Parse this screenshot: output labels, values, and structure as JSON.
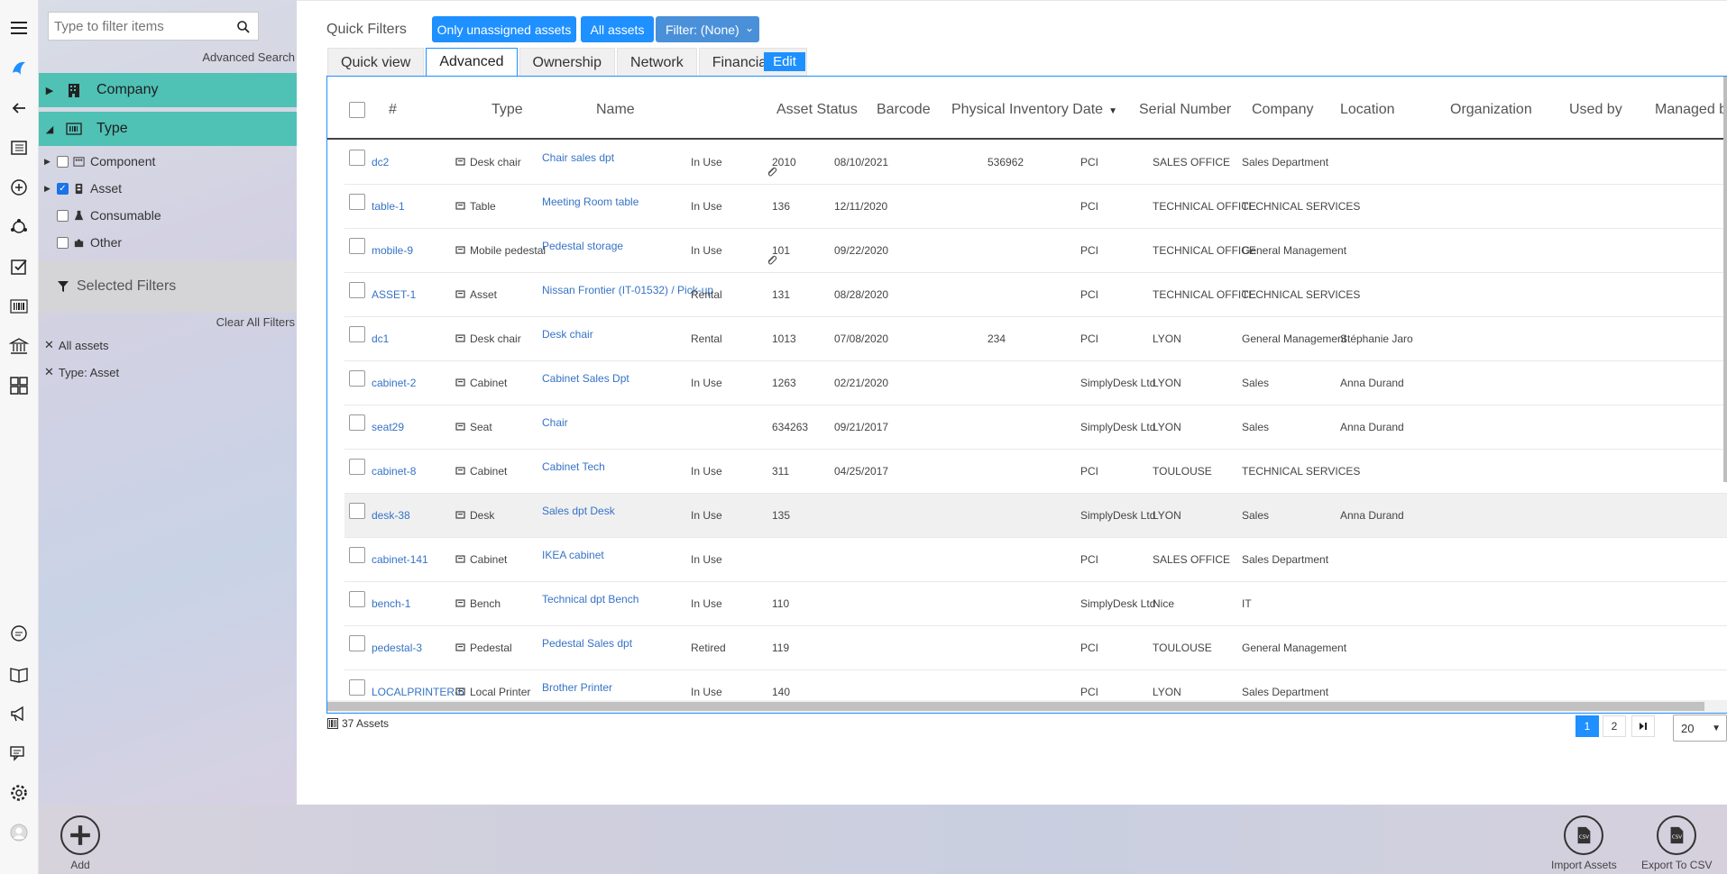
{
  "sidebar": {
    "filter_placeholder": "Type to filter items",
    "advanced_search": "Advanced Search",
    "groups": [
      {
        "label": "Company",
        "icon": "building-icon"
      },
      {
        "label": "Type",
        "icon": "barcode-icon"
      }
    ],
    "type_items": [
      {
        "label": "Component",
        "checked": false,
        "icon": "component-icon"
      },
      {
        "label": "Asset",
        "checked": true,
        "icon": "asset-icon"
      },
      {
        "label": "Consumable",
        "checked": false,
        "icon": "consumable-icon"
      },
      {
        "label": "Other",
        "checked": false,
        "icon": "puzzle-icon"
      }
    ],
    "selected_filters_label": "Selected Filters",
    "clear_all": "Clear All Filters",
    "active_filters": [
      "All assets",
      "Type: Asset"
    ]
  },
  "quick_filters": {
    "label": "Quick Filters",
    "buttons": [
      "Only unassigned assets",
      "All assets",
      "Filter: (None)"
    ]
  },
  "tabs": [
    "Quick view",
    "Advanced",
    "Ownership",
    "Network",
    "Financial"
  ],
  "active_tab": "Advanced",
  "edit_label": "Edit",
  "grid": {
    "columns": [
      "#",
      "Type",
      "Name",
      "Asset Status",
      "Barcode",
      "Physical Inventory Date",
      "Serial Number",
      "Company",
      "Location",
      "Organization",
      "Used by",
      "Managed b"
    ],
    "sorted_column": "Physical Inventory Date",
    "rows": [
      {
        "id": "dc2",
        "type": "Desk chair",
        "name": "Chair sales dpt",
        "status": "In Use",
        "barcode": "2010",
        "date": "08/10/2021",
        "serial": "536962",
        "company": "PCI",
        "location": "SALES OFFICE",
        "org": "Sales Department",
        "used_by": "",
        "attachment": true
      },
      {
        "id": "table-1",
        "type": "Table",
        "name": "Meeting Room table",
        "status": "In Use",
        "barcode": "136",
        "date": "12/11/2020",
        "serial": "",
        "company": "PCI",
        "location": "TECHNICAL OFFICE",
        "org": "TECHNICAL SERVICES",
        "used_by": "",
        "attachment": false
      },
      {
        "id": "mobile-9",
        "type": "Mobile pedestal",
        "name": "Pedestal storage",
        "status": "In Use",
        "barcode": "101",
        "date": "09/22/2020",
        "serial": "",
        "company": "PCI",
        "location": "TECHNICAL OFFICE",
        "org": "General Management",
        "used_by": "",
        "attachment": true
      },
      {
        "id": "ASSET-1",
        "type": "Asset",
        "name": "Nissan Frontier (IT-01532) / Pick-up",
        "status": "Rental",
        "barcode": "131",
        "date": "08/28/2020",
        "serial": "",
        "company": "PCI",
        "location": "TECHNICAL OFFICE",
        "org": "TECHNICAL SERVICES",
        "used_by": "",
        "attachment": false
      },
      {
        "id": "dc1",
        "type": "Desk chair",
        "name": "Desk chair",
        "status": "Rental",
        "barcode": "1013",
        "date": "07/08/2020",
        "serial": "234",
        "company": "PCI",
        "location": "LYON",
        "org": "General Management",
        "used_by": "Stéphanie Jaro",
        "attachment": false
      },
      {
        "id": "cabinet-2",
        "type": "Cabinet",
        "name": "Cabinet Sales Dpt",
        "status": "In Use",
        "barcode": "1263",
        "date": "02/21/2020",
        "serial": "",
        "company": "SimplyDesk Ltd",
        "location": "LYON",
        "org": "Sales",
        "used_by": "Anna Durand",
        "attachment": false
      },
      {
        "id": "seat29",
        "type": "Seat",
        "name": "Chair",
        "status": "",
        "barcode": "634263",
        "date": "09/21/2017",
        "serial": "",
        "company": "SimplyDesk Ltd",
        "location": "LYON",
        "org": "Sales",
        "used_by": "Anna Durand",
        "attachment": false
      },
      {
        "id": "cabinet-8",
        "type": "Cabinet",
        "name": "Cabinet Tech",
        "status": "In Use",
        "barcode": "311",
        "date": "04/25/2017",
        "serial": "",
        "company": "PCI",
        "location": "TOULOUSE",
        "org": "TECHNICAL SERVICES",
        "used_by": "",
        "attachment": false
      },
      {
        "id": "desk-38",
        "type": "Desk",
        "name": "Sales dpt Desk",
        "status": "In Use",
        "barcode": "135",
        "date": "",
        "serial": "",
        "company": "SimplyDesk Ltd",
        "location": "LYON",
        "org": "Sales",
        "used_by": "Anna Durand",
        "attachment": false
      },
      {
        "id": "cabinet-141",
        "type": "Cabinet",
        "name": "IKEA cabinet",
        "status": "In Use",
        "barcode": "",
        "date": "",
        "serial": "",
        "company": "PCI",
        "location": "SALES OFFICE",
        "org": "Sales Department",
        "used_by": "",
        "attachment": false
      },
      {
        "id": "bench-1",
        "type": "Bench",
        "name": "Technical dpt Bench",
        "status": "In Use",
        "barcode": "110",
        "date": "",
        "serial": "",
        "company": "SimplyDesk Ltd",
        "location": "Nice",
        "org": "IT",
        "used_by": "",
        "attachment": false
      },
      {
        "id": "pedestal-3",
        "type": "Pedestal",
        "name": "Pedestal Sales dpt",
        "status": "Retired",
        "barcode": "119",
        "date": "",
        "serial": "",
        "company": "PCI",
        "location": "TOULOUSE",
        "org": "General Management",
        "used_by": "",
        "attachment": false
      },
      {
        "id": "LOCALPRINTER-6",
        "type": "Local Printer",
        "name": "Brother Printer",
        "status": "In Use",
        "barcode": "140",
        "date": "",
        "serial": "",
        "company": "PCI",
        "location": "LYON",
        "org": "Sales Department",
        "used_by": "",
        "attachment": false
      }
    ]
  },
  "footer_count": "37 Assets",
  "pagination": {
    "pages": [
      "1",
      "2"
    ],
    "current": "1",
    "page_size": "20"
  },
  "footer_actions": {
    "add": "Add",
    "import": "Import Assets",
    "export": "Export To CSV"
  },
  "colors": {
    "accent": "#1e90ff",
    "group_header": "#4fc1b5",
    "link": "#3573c6"
  }
}
